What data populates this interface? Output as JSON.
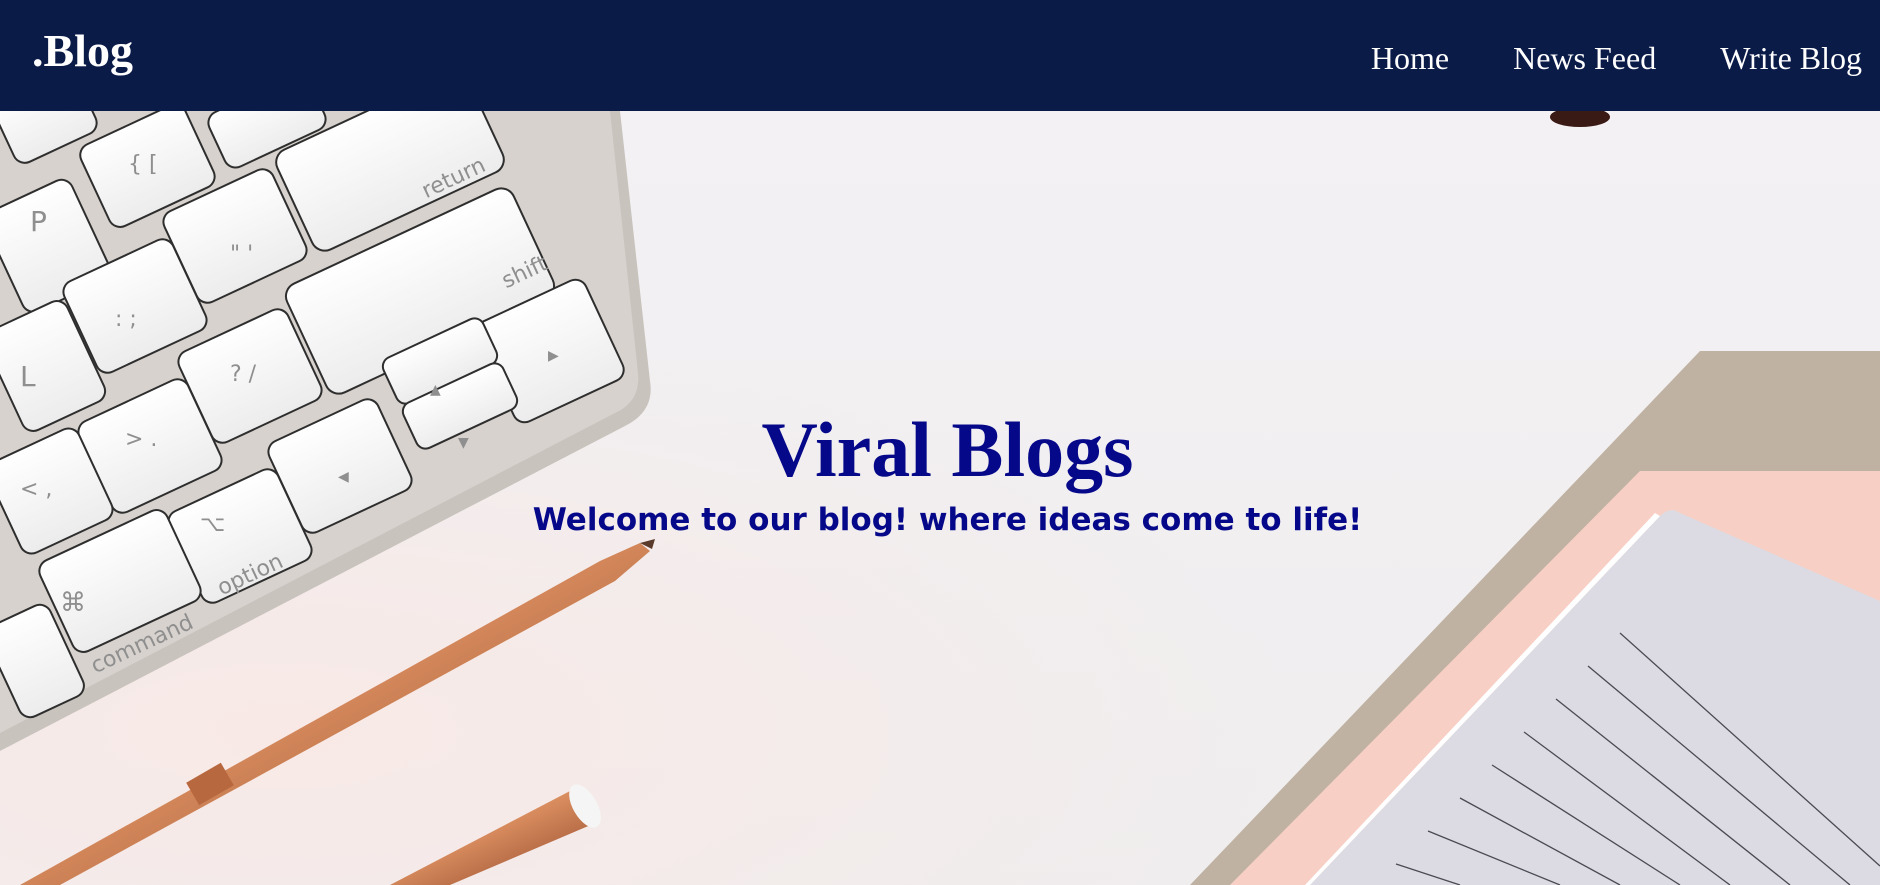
{
  "navbar": {
    "brand": ".Blog",
    "links": [
      {
        "label": "Home"
      },
      {
        "label": "News Feed"
      },
      {
        "label": "Write Blog"
      }
    ]
  },
  "hero": {
    "title": "Viral Blogs",
    "subtitle": "Welcome to our blog! where ideas come to life!",
    "keyboard_keys": [
      "{ [",
      "\" '",
      ": ;",
      "? /",
      "< ,",
      "> .",
      "P",
      "L",
      "return",
      "shift",
      "option",
      "command",
      "⌘",
      "⌥",
      "▲",
      "▼",
      "◀",
      "▶"
    ]
  },
  "colors": {
    "navbar_bg": "#0b1b48",
    "nav_text": "#ffffff",
    "hero_text": "#06088a",
    "copper": "#c8784f",
    "notebook": "#dcdbe3",
    "blush": "#f7cfc4",
    "tan": "#bfb2a2"
  }
}
